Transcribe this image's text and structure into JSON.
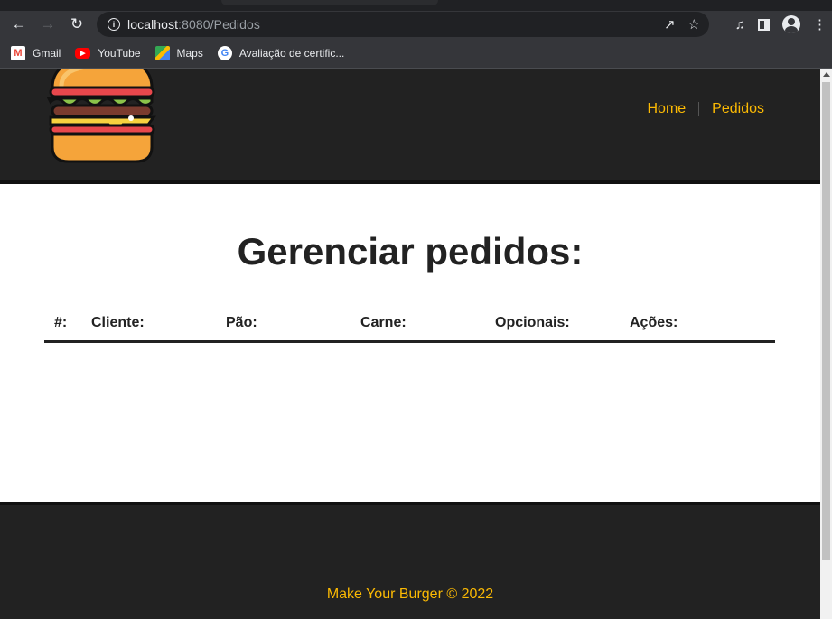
{
  "browser": {
    "url_host": "localhost",
    "url_rest": ":8080/Pedidos",
    "bookmarks": [
      "Gmail",
      "YouTube",
      "Maps",
      "Avaliação de certific..."
    ]
  },
  "header": {
    "nav": {
      "home": "Home",
      "orders": "Pedidos"
    }
  },
  "main": {
    "title": "Gerenciar pedidos:",
    "table_headers": [
      "#:",
      "Cliente:",
      "Pão:",
      "Carne:",
      "Opcionais:",
      "Ações:"
    ]
  },
  "footer": {
    "text": "Make Your Burger © 2022"
  },
  "colors": {
    "accent": "#fcba03",
    "dark": "#222222"
  }
}
